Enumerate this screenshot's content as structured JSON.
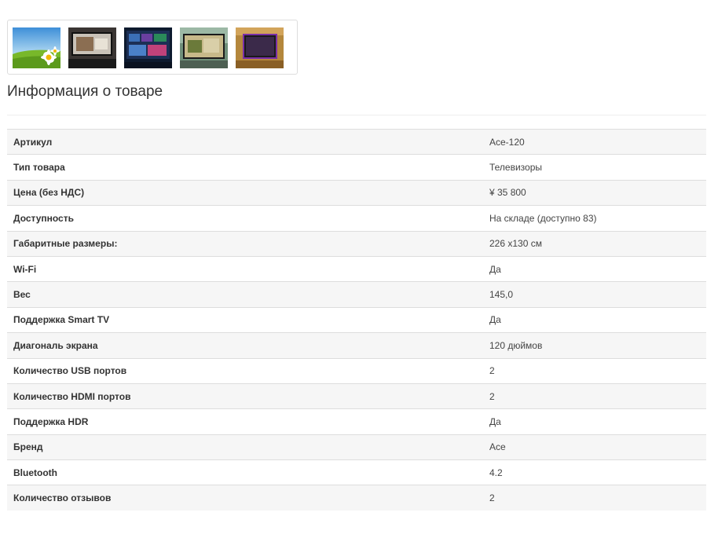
{
  "gallery": {
    "thumbnails": [
      {
        "icon": "daisy-field-photo"
      },
      {
        "icon": "tv-on-wall-photo"
      },
      {
        "icon": "tv-screen-interface-photo"
      },
      {
        "icon": "tv-in-room-photo"
      },
      {
        "icon": "tv-purple-light-photo"
      }
    ]
  },
  "product_info": {
    "title": "Информация о товаре",
    "rows": [
      {
        "key": "Артикул",
        "value": "Ace-120"
      },
      {
        "key": "Тип товара",
        "value": "Телевизоры"
      },
      {
        "key": "Цена (без НДС)",
        "value": "¥ 35 800"
      },
      {
        "key": "Доступность",
        "value": "На складе (доступно 83)"
      },
      {
        "key": "Габаритные размеры:",
        "value": "226 х130 см"
      },
      {
        "key": "Wi-Fi",
        "value": "Да"
      },
      {
        "key": "Вес",
        "value": "145,0"
      },
      {
        "key": "Поддержка Smart TV",
        "value": "Да"
      },
      {
        "key": "Диагональ экрана",
        "value": "120 дюймов"
      },
      {
        "key": "Количество USB портов",
        "value": "2"
      },
      {
        "key": "Количество HDMI портов",
        "value": "2"
      },
      {
        "key": "Поддержка HDR",
        "value": "Да"
      },
      {
        "key": "Бренд",
        "value": "Ace"
      },
      {
        "key": "Bluetooth",
        "value": "4.2"
      },
      {
        "key": "Количество отзывов",
        "value": "2"
      }
    ]
  }
}
